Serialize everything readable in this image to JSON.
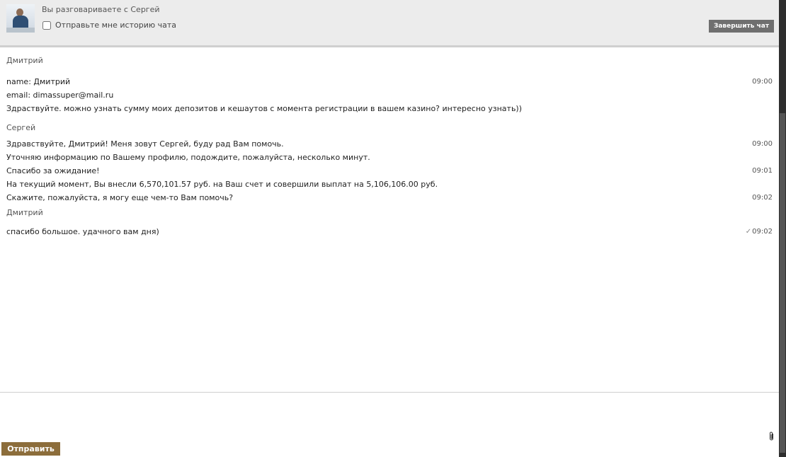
{
  "header": {
    "conversation_title": "Вы разговариваете с Сергей",
    "history_checkbox_label": "Отправьте мне историю чата",
    "history_checked": false,
    "end_chat_label": "Завершить чат"
  },
  "messages": {
    "group1": {
      "sender": "Дмитрий",
      "lines": [
        {
          "text": "name: Дмитрий",
          "time": "09:00"
        },
        {
          "text": "email: dimassuper@mail.ru",
          "time": ""
        },
        {
          "text": "Здраствуйте. можно узнать сумму моих депозитов и кешаутов с момента регистрации в вашем казино? интересно узнать))",
          "time": ""
        }
      ]
    },
    "group2": {
      "sender": "Сергей",
      "lines": [
        {
          "text": "Здравствуйте, Дмитрий! Меня зовут Сергей, буду рад Вам помочь.",
          "time": "09:00"
        },
        {
          "text": "Уточняю информацию по Вашему профилю, подождите, пожалуйста, несколько минут.",
          "time": ""
        },
        {
          "text": "Спасибо за ожидание!",
          "time": "09:01"
        },
        {
          "text": "На текущий момент, Вы внесли 6,570,101.57 руб. на Ваш счет и совершили выплат на 5,106,106.00 руб.",
          "time": ""
        },
        {
          "text": "Скажите, пожалуйста, я могу еще чем-то Вам помочь?",
          "time": "09:02"
        }
      ]
    },
    "group3": {
      "sender": "Дмитрий",
      "lines": [
        {
          "text": "спасибо большое. удачного вам дня)",
          "time": "09:02",
          "check": "✓"
        }
      ]
    }
  },
  "footer": {
    "send_label": "Отправить",
    "attach_icon": "paperclip-icon"
  },
  "colors": {
    "send_button": "#8c6d3b",
    "end_chat_button": "#6f6f6f",
    "header_bg": "#ececec"
  }
}
